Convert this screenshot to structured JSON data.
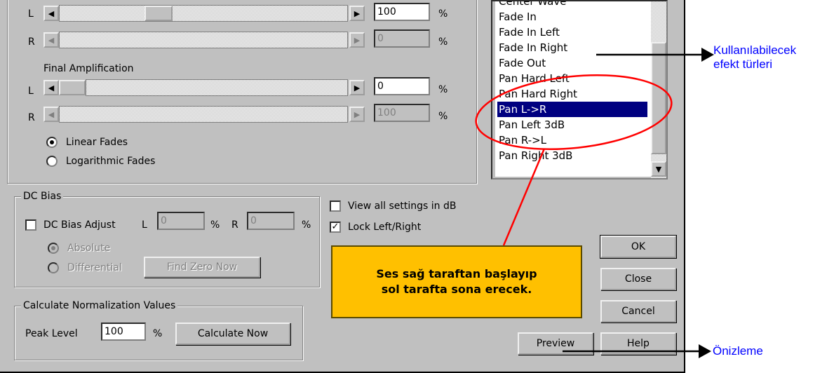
{
  "top_amplification": {
    "left_label": "L",
    "left_value": "100",
    "right_label": "R",
    "right_value": "0",
    "percent": "%"
  },
  "final_amplification": {
    "title": "Final Amplification",
    "left_label": "L",
    "left_value": "0",
    "right_label": "R",
    "right_value": "100",
    "percent": "%"
  },
  "fades": {
    "linear": "Linear Fades",
    "logarithmic": "Logarithmic Fades",
    "selected": "linear"
  },
  "dc_bias": {
    "title": "DC Bias",
    "adjust_label": "DC Bias Adjust",
    "adjust_checked": false,
    "left_label": "L",
    "left_value": "0",
    "right_label": "R",
    "right_value": "0",
    "percent": "%",
    "absolute": "Absolute",
    "differential": "Differential",
    "find_zero_button": "Find Zero Now"
  },
  "settings": {
    "view_db": "View all settings in dB",
    "view_db_checked": false,
    "lock_lr": "Lock Left/Right",
    "lock_lr_checked": true
  },
  "normalization": {
    "title": "Calculate Normalization Values",
    "peak_label": "Peak Level",
    "peak_value": "100",
    "percent": "%",
    "calculate_button": "Calculate Now"
  },
  "effects_list": {
    "items": [
      "Center Wave",
      "Fade In",
      "Fade In Left",
      "Fade In Right",
      "Fade Out",
      "Pan Hard Left",
      "Pan Hard Right",
      "Pan L->R",
      "Pan Left 3dB",
      "Pan R->L",
      "Pan Right 3dB"
    ],
    "selected": "Pan L->R"
  },
  "buttons": {
    "ok": "OK",
    "close": "Close",
    "cancel": "Cancel",
    "preview": "Preview",
    "help": "Help"
  },
  "callout": {
    "line1": "Ses sağ taraftan başlayıp",
    "line2": "sol tarafta sona erecek."
  },
  "annotations": {
    "effects_line1": "Kullanılabilecek",
    "effects_line2": "efekt türleri",
    "preview": "Önizleme"
  },
  "colors": {
    "dialog": "#c0c0c0",
    "selection": "#000080",
    "callout": "#ffc000",
    "annotation_text": "#0000ff",
    "ellipse": "#ff0000"
  }
}
